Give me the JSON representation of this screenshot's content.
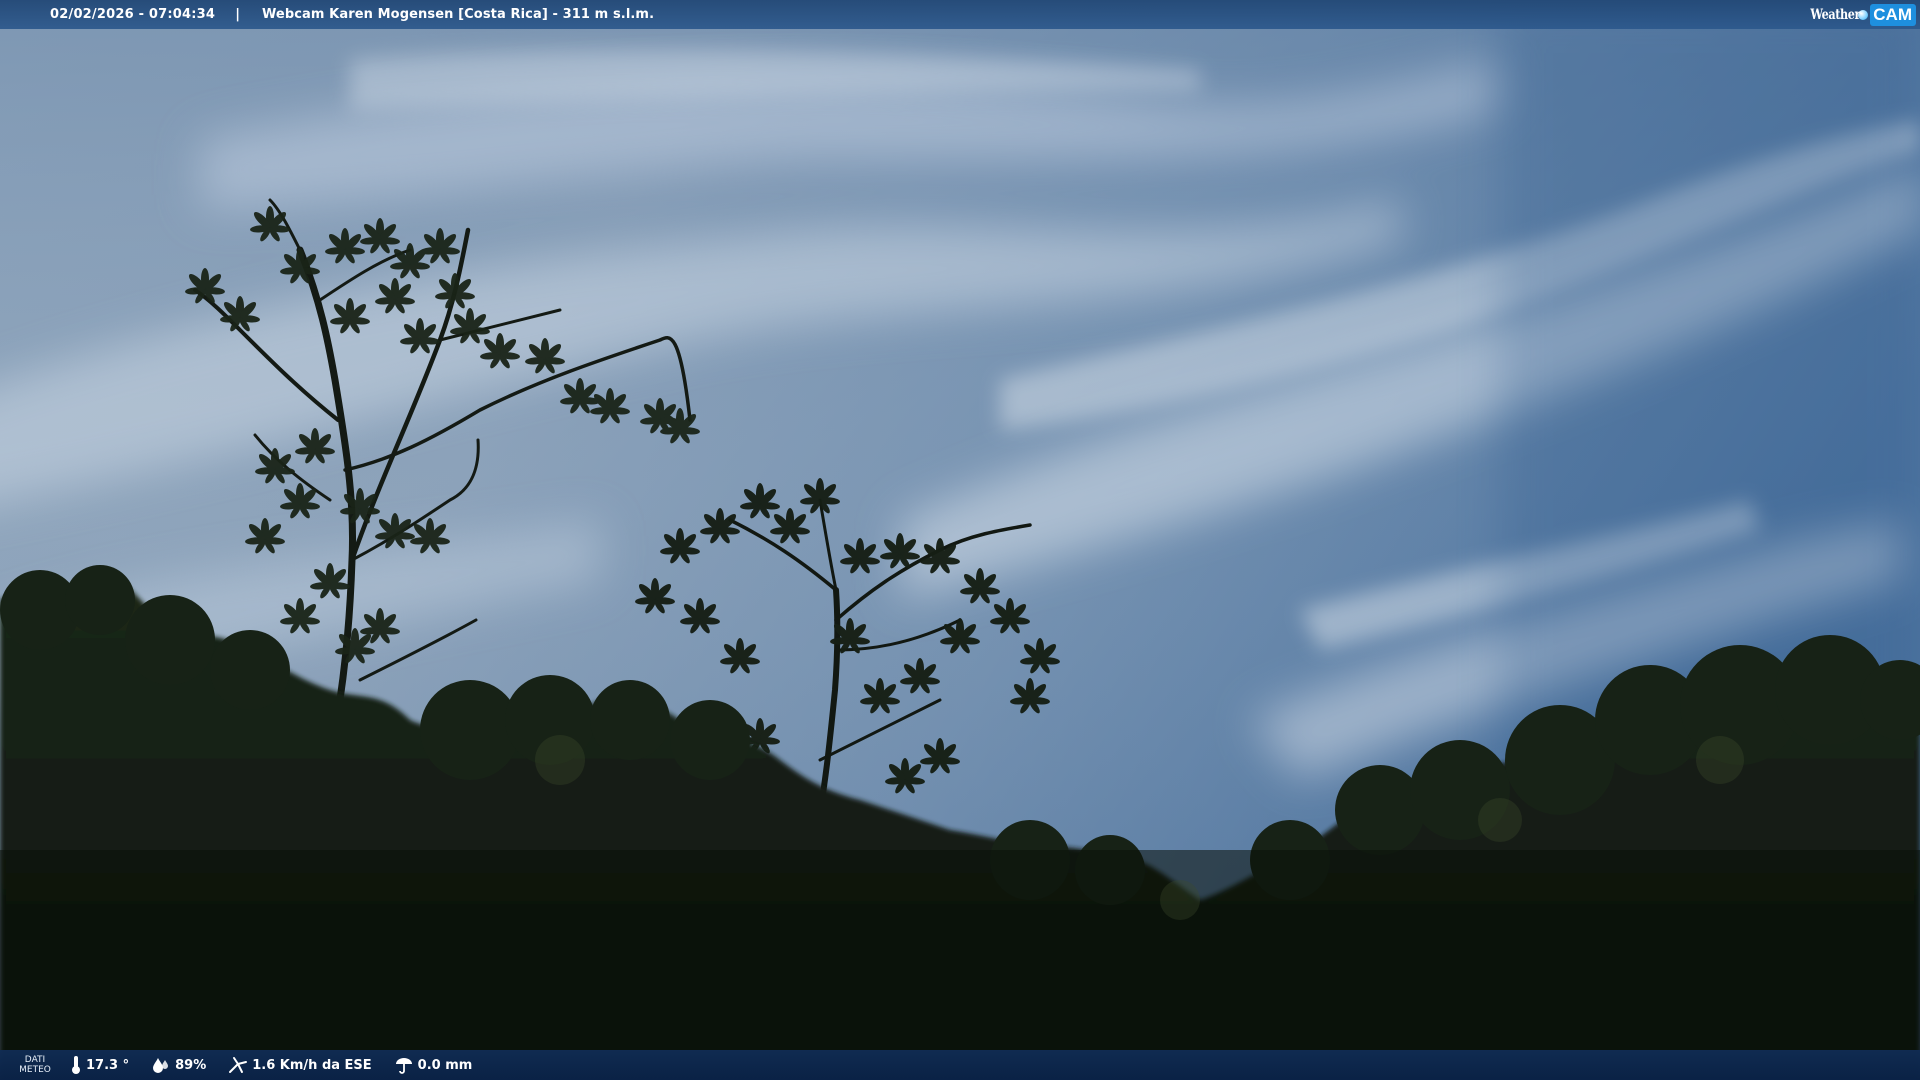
{
  "overlay": {
    "timestamp": "02/02/2026 - 07:04:34",
    "separator": "|",
    "camera_title": "Webcam Karen Mogensen [Costa Rica]  - 311 m s.l.m.",
    "logo_weather": "Weather",
    "logo_cam": "CAM"
  },
  "weather_data": {
    "label_line1": "DATI",
    "label_line2": "METEO",
    "temperature": "17.3 °",
    "humidity": "89%",
    "wind": "1.6 Km/h da ESE",
    "rain": "0.0 mm"
  },
  "icons": {
    "temperature": "thermometer-icon",
    "humidity": "humidity-icon",
    "wind": "wind-icon",
    "rain": "rain-icon"
  },
  "colors": {
    "top_bar": "#2c588c",
    "bottom_bar": "#0e2c54",
    "logo_cam_bg": "#1e8fde",
    "sky_light": "#9fb3c8",
    "sky_deep": "#3f6796",
    "foliage": "#10160f"
  }
}
